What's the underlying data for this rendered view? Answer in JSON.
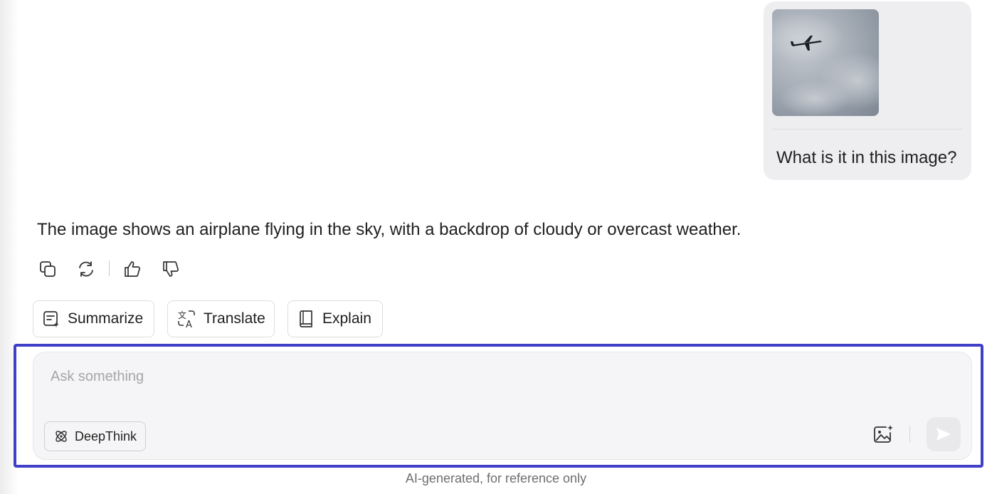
{
  "user_message": {
    "text": "What is it in this image?",
    "image_alt_icon": "airplane-in-cloudy-sky-photo"
  },
  "assistant_message": {
    "text": "The image shows an airplane flying in the sky, with a backdrop of cloudy or overcast weather."
  },
  "message_actions": {
    "icons": [
      "copy-icon",
      "regenerate-icon",
      "thumbs-up-icon",
      "thumbs-down-icon"
    ]
  },
  "suggestions": [
    {
      "label": "Summarize",
      "icon": "summarize-icon"
    },
    {
      "label": "Translate",
      "icon": "translate-icon"
    },
    {
      "label": "Explain",
      "icon": "book-icon"
    }
  ],
  "composer": {
    "placeholder": "Ask something",
    "deepthink_label": "DeepThink",
    "focus_color": "#3f3fc8"
  },
  "footer": {
    "note": "AI-generated, for reference only"
  }
}
